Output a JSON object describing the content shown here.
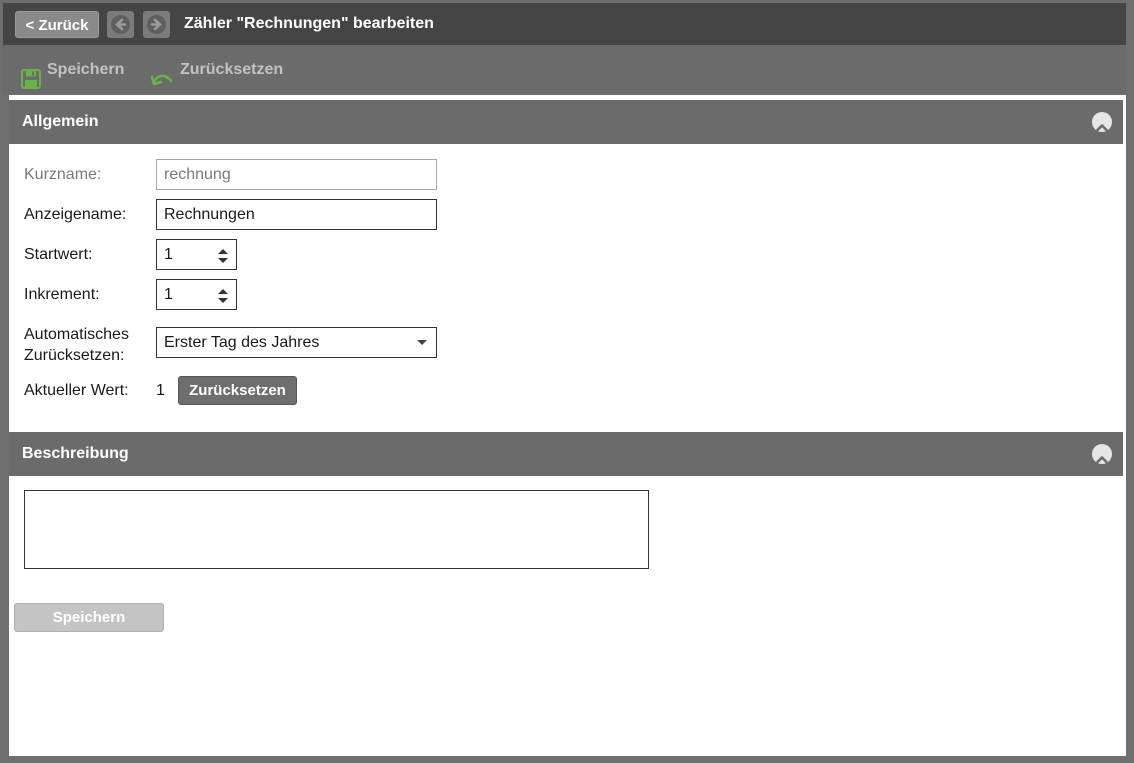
{
  "titlebar": {
    "back_label": "< Zurück",
    "title": "Zähler \"Rechnungen\" bearbeiten"
  },
  "toolbar": {
    "save_label": "Speichern",
    "reset_label": "Zurücksetzen"
  },
  "sections": {
    "general": {
      "title": "Allgemein"
    },
    "description": {
      "title": "Beschreibung"
    }
  },
  "form": {
    "short_name": {
      "label": "Kurzname:",
      "value": "rechnung"
    },
    "display_name": {
      "label": "Anzeigename:",
      "value": "Rechnungen"
    },
    "start_value": {
      "label": "Startwert:",
      "value": "1"
    },
    "increment": {
      "label": "Inkrement:",
      "value": "1"
    },
    "auto_reset": {
      "label_line1": "Automatisches",
      "label_line2": "Zurücksetzen:",
      "selected": "Erster Tag des Jahres"
    },
    "current_value": {
      "label": "Aktueller Wert:",
      "value": "1",
      "reset_button": "Zurücksetzen"
    }
  },
  "description": {
    "value": ""
  },
  "footer": {
    "save_label": "Speichern"
  },
  "colors": {
    "header_bg": "#454545",
    "toolbar_bg": "#6b6b6b",
    "section_bg": "#6b6b6b",
    "save_icon": "#6cb04a",
    "undo_icon": "#6cb04a"
  },
  "icons": {
    "prev": "arrow-left-circle-icon",
    "next": "arrow-right-circle-icon",
    "save": "floppy-disk-icon",
    "undo": "undo-arrow-icon",
    "collapse": "chevron-up-circle-icon"
  }
}
